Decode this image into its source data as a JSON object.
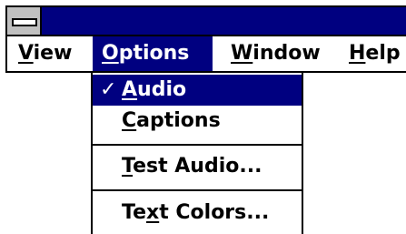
{
  "menu": {
    "view": {
      "pre": "",
      "key": "V",
      "post": "iew"
    },
    "options": {
      "pre": "",
      "key": "O",
      "post": "ptions"
    },
    "window": {
      "pre": "",
      "key": "W",
      "post": "indow"
    },
    "help": {
      "pre": "",
      "key": "H",
      "post": "elp"
    }
  },
  "dropdown": {
    "audio": {
      "check": "✓",
      "pre": "",
      "key": "A",
      "post": "udio",
      "checked": true
    },
    "captions": {
      "pre": "",
      "key": "C",
      "post": "aptions"
    },
    "test_audio": {
      "pre": "",
      "key": "T",
      "post": "est Audio..."
    },
    "text_colors": {
      "pre": "Te",
      "key": "x",
      "post": "t Colors..."
    }
  },
  "colors": {
    "titlebar": "#000080",
    "highlight": "#000080",
    "system_box": "#c0c0c0"
  },
  "icons": {
    "system_menu": "system-menu-icon",
    "check": "check-icon"
  }
}
